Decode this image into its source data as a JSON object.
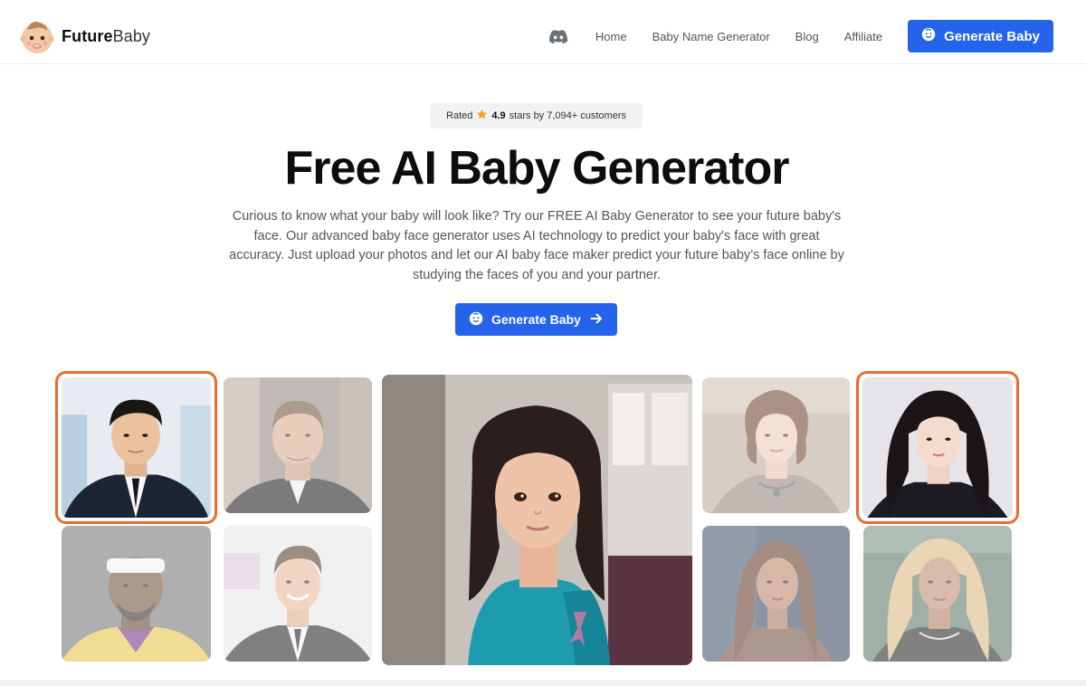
{
  "brand": {
    "name_bold": "Future",
    "name_light": "Baby"
  },
  "nav": {
    "discord_icon": "discord-icon",
    "links": [
      "Home",
      "Baby Name Generator",
      "Blog",
      "Affiliate"
    ],
    "cta_label": "Generate Baby"
  },
  "rating": {
    "prefix": "Rated",
    "score": "4.9",
    "suffix": "stars by 7,094+ customers"
  },
  "hero": {
    "title": "Free AI Baby Generator",
    "description": "Curious to know what your baby will look like? Try our FREE AI Baby Generator to see your future baby's face. Our advanced baby face generator uses AI technology to predict your baby's face with great accuracy. Just upload your photos and let our AI baby face maker predict your future baby’s face online by studying the faces of you and your partner.",
    "cta_label": "Generate Baby"
  },
  "gallery": {
    "photos": [
      {
        "name": "photo-male-selected",
        "selected": true
      },
      {
        "name": "photo-male-2",
        "selected": false
      },
      {
        "name": "photo-male-3",
        "selected": false
      },
      {
        "name": "photo-male-4",
        "selected": false
      },
      {
        "name": "photo-baby-result",
        "selected": false
      },
      {
        "name": "photo-female-2",
        "selected": false
      },
      {
        "name": "photo-female-selected",
        "selected": true
      },
      {
        "name": "photo-female-3",
        "selected": false
      },
      {
        "name": "photo-female-4",
        "selected": false
      }
    ]
  },
  "colors": {
    "primary": "#2563eb",
    "selection": "#ee6a2c",
    "star": "#f5a623"
  }
}
